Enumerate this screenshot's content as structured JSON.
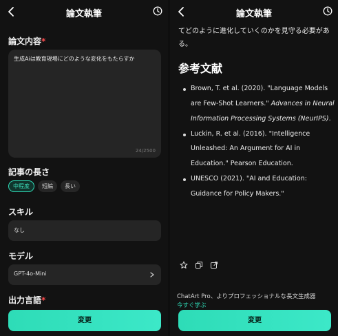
{
  "left": {
    "title": "論文執筆",
    "content_label": "論文内容",
    "required_mark": "*",
    "content_value": "生成Aiは教育現場にどのような変化をもたらすか",
    "char_count": "24/2500",
    "length_label": "記事の長さ",
    "length_options": [
      "中程度",
      "短編",
      "長い"
    ],
    "skill_label": "スキル",
    "skill_value": "なし",
    "model_label": "モデル",
    "model_value": "GPT-4o-Mini",
    "output_lang_label": "出力言語",
    "submit_label": "変更"
  },
  "right": {
    "title": "論文執筆",
    "intro_text": "てどのように進化していくのかを見守る必要がある。",
    "refs_heading": "参考文献",
    "refs": [
      {
        "plain": "Brown, T. et al. (2020). \"Language Models are Few-Shot Learners.\" ",
        "italic": "Advances in Neural Information Processing Systems (NeurIPS)",
        "tail": "."
      },
      {
        "plain": "Luckin, R. et al. (2016). \"Intelligence Unleashed: An Argument for AI in Education.\" Pearson Education.",
        "italic": "",
        "tail": ""
      },
      {
        "plain": "UNESCO (2021). \"AI and Education: Guidance for Policy Makers.\"",
        "italic": "",
        "tail": ""
      }
    ],
    "promo_text": "ChatArt Pro、よりプロフェッショナルな長文生成器",
    "promo_link": "今すぐ学ぶ",
    "submit_label": "変更"
  },
  "colors": {
    "accent": "#2fd8b4",
    "required": "#ff4d4f",
    "background": "#121212",
    "field": "#252525"
  },
  "icons": [
    "back-arrow-icon",
    "history-clock-icon",
    "chevron-right-icon",
    "star-icon",
    "copy-icon",
    "share-icon"
  ]
}
